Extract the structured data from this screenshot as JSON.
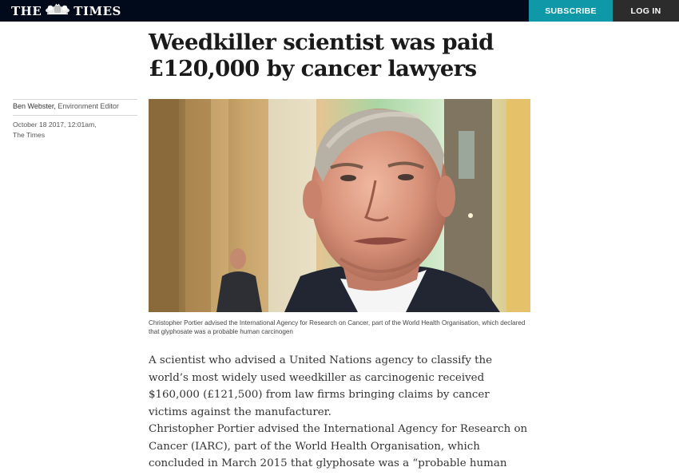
{
  "header": {
    "logo_left": "THE",
    "logo_right": "TIMES",
    "subscribe_label": "SUBSCRIBE",
    "login_label": "LOG IN",
    "background_color": "#000a1a",
    "subscribe_color": "#0e98a8"
  },
  "article": {
    "headline": "Weedkiller scientist was paid £120,000 by cancer lawyers",
    "author": "Ben Webster",
    "author_role": "Environment Editor",
    "date": "October 18 2017, 12:01am,",
    "publication": "The Times",
    "image_caption": "Christopher Portier advised the International Agency for Research on Cancer, part of the World Health Organisation, which declared that glyphosate was a probable human carcinogen",
    "paragraphs": [
      "A scientist who advised a United Nations agency to classify the world’s most widely used weedkiller as carcinogenic received $160,000 (£121,500) from law firms bringing claims by cancer victims against the manufacturer.",
      "Christopher Portier advised the International Agency for Research on Cancer (IARC), part of the World Health Organisation, which concluded in March 2015 that glyphosate was a “probable human carcinogen”."
    ]
  }
}
